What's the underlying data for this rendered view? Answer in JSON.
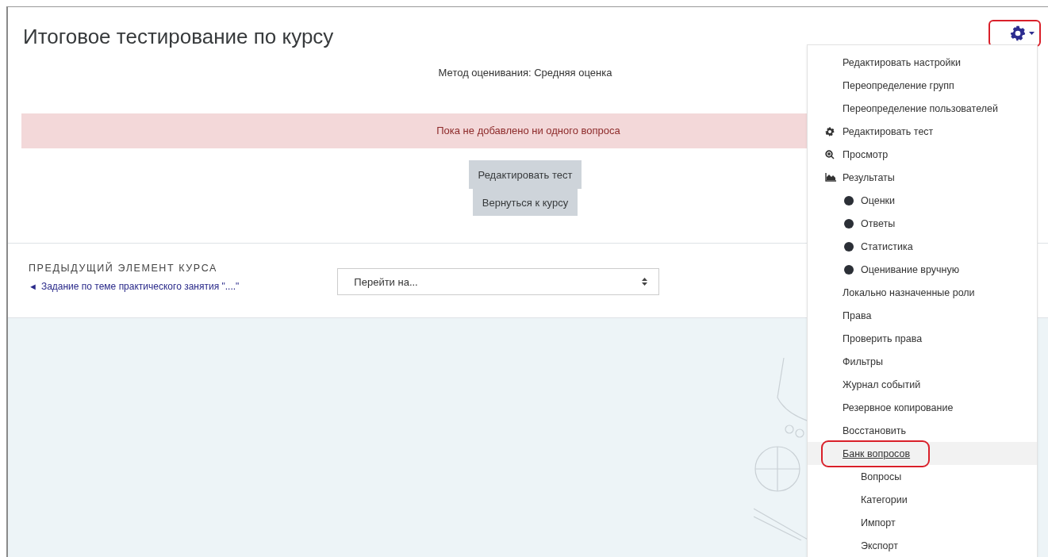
{
  "page": {
    "title": "Итоговое тестирование по курсу",
    "grading_method": "Метод оценивания: Средняя оценка",
    "alert": "Пока не добавлено ни одного вопроса",
    "buttons": [
      "Редактировать тест",
      "Вернуться к курсу"
    ]
  },
  "navigation": {
    "previous_heading": "ПРЕДЫДУЩИЙ ЭЛЕМЕНТ КУРСА",
    "previous_arrow": "◄",
    "previous_link": "Задание по теме практического занятия \"....\"",
    "jump_select": {
      "value": "Перейти на..."
    }
  },
  "settings_menu": {
    "circled": true,
    "expanded": true,
    "items": [
      {
        "label": "Редактировать настройки",
        "kind": "link",
        "hovered": false,
        "circled": false
      },
      {
        "label": "Переопределение групп",
        "kind": "link",
        "hovered": false,
        "circled": false
      },
      {
        "label": "Переопределение пользователей",
        "kind": "link",
        "hovered": false,
        "circled": false
      },
      {
        "label": "Редактировать тест",
        "kind": "settings",
        "hovered": false,
        "circled": false
      },
      {
        "label": "Просмотр",
        "kind": "preview",
        "hovered": false,
        "circled": false
      },
      {
        "label": "Результаты",
        "kind": "report",
        "hovered": false,
        "circled": false,
        "children": [
          {
            "label": "Оценки",
            "kind": "bullet",
            "hovered": false,
            "circled": false
          },
          {
            "label": "Ответы",
            "kind": "bullet",
            "hovered": false,
            "circled": false
          },
          {
            "label": "Статистика",
            "kind": "bullet",
            "hovered": false,
            "circled": false
          },
          {
            "label": "Оценивание вручную",
            "kind": "bullet",
            "hovered": false,
            "circled": false
          }
        ]
      },
      {
        "label": "Локально назначенные роли",
        "kind": "link",
        "hovered": false,
        "circled": false
      },
      {
        "label": "Права",
        "kind": "link",
        "hovered": false,
        "circled": false
      },
      {
        "label": "Проверить права",
        "kind": "link",
        "hovered": false,
        "circled": false
      },
      {
        "label": "Фильтры",
        "kind": "link",
        "hovered": false,
        "circled": false
      },
      {
        "label": "Журнал событий",
        "kind": "link",
        "hovered": false,
        "circled": false
      },
      {
        "label": "Резервное копирование",
        "kind": "link",
        "hovered": false,
        "circled": false
      },
      {
        "label": "Восстановить",
        "kind": "link",
        "hovered": false,
        "circled": false
      },
      {
        "label": "Банк вопросов",
        "kind": "link",
        "hovered": true,
        "circled": true,
        "children": [
          {
            "label": "Вопросы",
            "kind": "link",
            "hovered": false,
            "circled": false
          },
          {
            "label": "Категории",
            "kind": "link",
            "hovered": false,
            "circled": false
          },
          {
            "label": "Импорт",
            "kind": "link",
            "hovered": false,
            "circled": false
          },
          {
            "label": "Экспорт",
            "kind": "link",
            "hovered": false,
            "circled": false
          }
        ]
      }
    ]
  }
}
